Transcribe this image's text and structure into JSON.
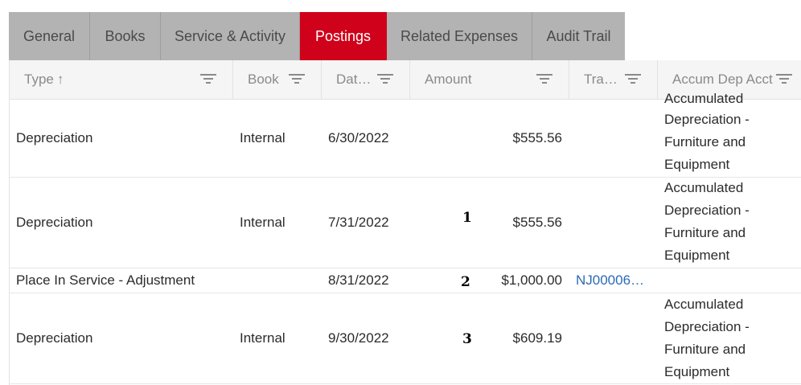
{
  "tabs": [
    {
      "label": "General"
    },
    {
      "label": "Books"
    },
    {
      "label": "Service & Activity"
    },
    {
      "label": "Postings"
    },
    {
      "label": "Related Expenses"
    },
    {
      "label": "Audit Trail"
    }
  ],
  "grid": {
    "headers": {
      "type": "Type",
      "type_sort": "↑",
      "book": "Book",
      "date": "Dat…",
      "amount": "Amount",
      "transaction": "Tra…",
      "accum_dep_acct": "Accum Dep Acct"
    },
    "rows": [
      {
        "type": "Depreciation",
        "book": "Internal",
        "date": "6/30/2022",
        "marker": "",
        "amount": "$555.56",
        "transaction": "",
        "acct_partial": "Accumulated",
        "acct": "Depreciation - Furniture and Equipment"
      },
      {
        "type": "Depreciation",
        "book": "Internal",
        "date": "7/31/2022",
        "marker": "1",
        "amount": "$555.56",
        "transaction": "",
        "acct": "Accumulated Depreciation - Furniture and Equipment"
      },
      {
        "type": "Place In Service - Adjustment",
        "book": "",
        "date": "8/31/2022",
        "marker": "2",
        "amount": "$1,000.00",
        "transaction": "NJ00006…",
        "acct": ""
      },
      {
        "type": "Depreciation",
        "book": "Internal",
        "date": "9/30/2022",
        "marker": "3",
        "amount": "$609.19",
        "transaction": "",
        "acct": "Accumulated Depreciation - Furniture and Equipment"
      }
    ]
  }
}
